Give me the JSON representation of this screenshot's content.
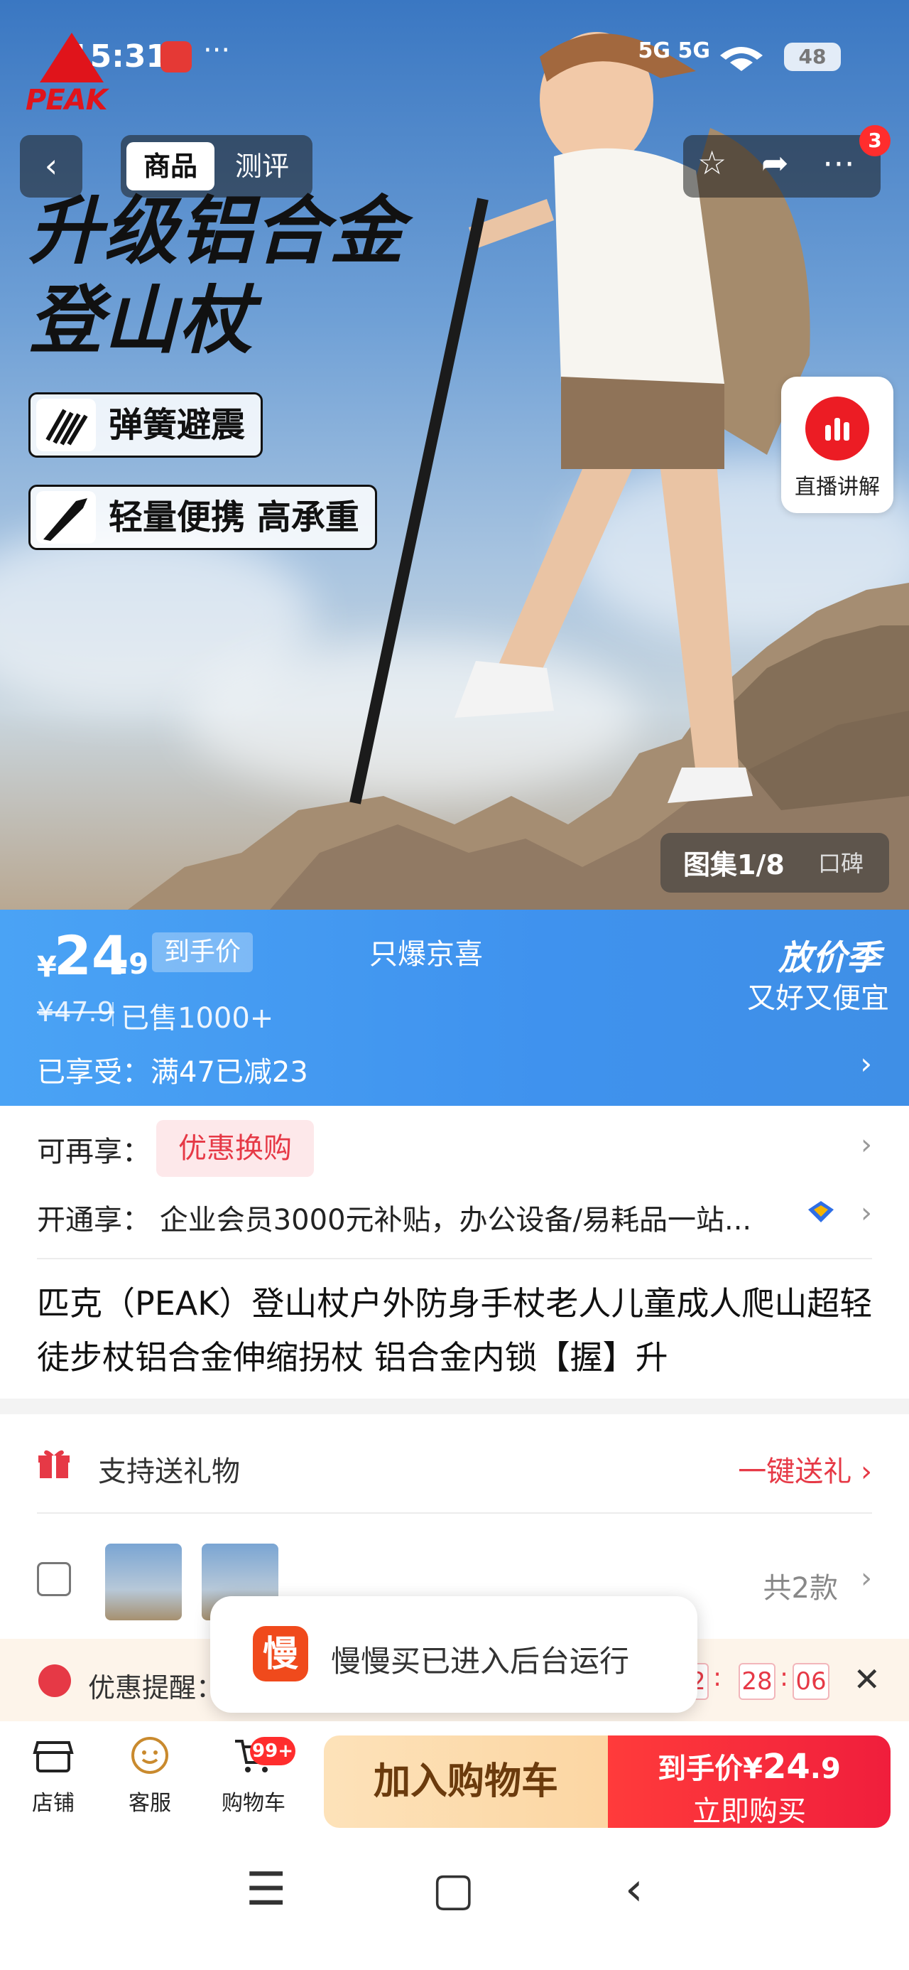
{
  "status": {
    "time": "15:31",
    "more": "···",
    "network": "5G 5G",
    "battery": "48"
  },
  "brand": {
    "logo_text": "PEAK"
  },
  "nav": {
    "back": "‹",
    "tabs": [
      "商品",
      "测评"
    ],
    "badge_count": "3"
  },
  "hero": {
    "title_line1": "升级铝合金",
    "title_line2": "登山杖",
    "features": [
      "弹簧避震",
      "轻量便携 高承重"
    ],
    "live_label": "直播讲解",
    "gallery": "图集1/8",
    "reviews": "口碑"
  },
  "price": {
    "currency": "¥",
    "integer": "24",
    "decimal": ".9",
    "tag": "到手价",
    "exclusive": "只爆京喜",
    "original": "¥47.9",
    "sold": "已售1000+",
    "promo": "已享受：满47已减23",
    "season_title": "放价季",
    "season_sub": "又好又便宜",
    "accent_color": "#3f92ee"
  },
  "offers": {
    "extra_label": "可再享：",
    "extra_chip": "优惠换购",
    "member_label": "开通享：",
    "member_text": "企业会员3000元补贴，办公设备/易耗品一站..."
  },
  "product": {
    "title": "匹克（PEAK）登山杖户外防身手杖老人儿童成人爬山超轻徒步杖铝合金伸缩拐杖 铝合金内锁【握】升"
  },
  "gift": {
    "label": "支持送礼物",
    "action": "一键送礼"
  },
  "styles": {
    "count": "共2款"
  },
  "reminder": {
    "label": "优惠提醒：",
    "hh": "32",
    "mm": "28",
    "ss": "06"
  },
  "toast": {
    "icon_char": "慢",
    "message": "慢慢买已进入后台运行"
  },
  "bottom": {
    "shop": "店铺",
    "service": "客服",
    "cart": "购物车",
    "cart_badge": "99+",
    "add_cart": "加入购物车",
    "buy_prefix": "到手价",
    "buy_currency": "¥",
    "buy_int": "24",
    "buy_dec": ".9",
    "buy_now": "立即购买"
  }
}
